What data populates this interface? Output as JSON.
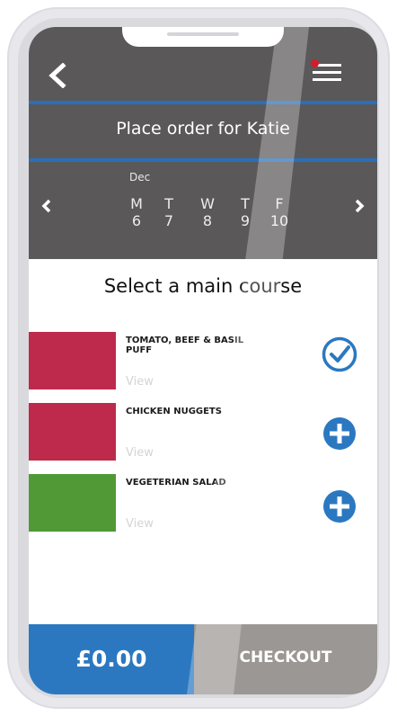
{
  "header": {
    "title": "Place order for Katie",
    "month": "Dec",
    "days": [
      {
        "letter": "M",
        "num": "6"
      },
      {
        "letter": "T",
        "num": "7"
      },
      {
        "letter": "W",
        "num": "8"
      },
      {
        "letter": "T",
        "num": "9"
      },
      {
        "letter": "F",
        "num": "10"
      }
    ]
  },
  "main": {
    "section_title": "Select a main course",
    "items": [
      {
        "name": "TOMATO, BEEF & BASIL PUFF",
        "view": "View",
        "color": "#bd2a4c",
        "state": "selected"
      },
      {
        "name": "CHICKEN NUGGETS",
        "view": "View",
        "color": "#bd2a4c",
        "state": "add"
      },
      {
        "name": "VEGETERIAN SALAD",
        "view": "View",
        "color": "#519936",
        "state": "add"
      }
    ]
  },
  "footer": {
    "total": "£0.00",
    "checkout": "CHECKOUT"
  },
  "colors": {
    "header_bg": "#5b5859",
    "accent_blue": "#2b78c1",
    "checkout_gray": "#9b9794",
    "notification_red": "#d41c2c"
  }
}
